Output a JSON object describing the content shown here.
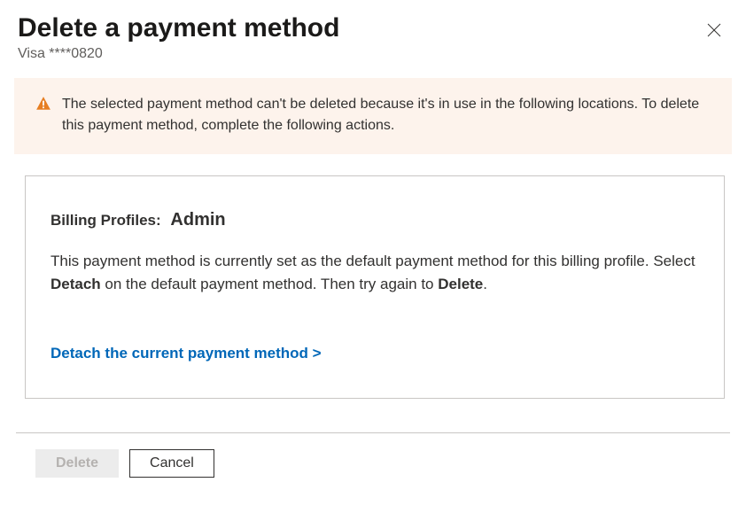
{
  "header": {
    "title": "Delete a payment method",
    "subtitle": "Visa ****0820"
  },
  "warning": {
    "text": "The selected payment method can't be deleted because it's in use in the following locations. To delete this payment method, complete the following actions."
  },
  "card": {
    "label": "Billing Profiles:",
    "value": "Admin",
    "description_pre": "This payment method is currently set as the default payment method for this billing profile. Select ",
    "description_bold1": "Detach",
    "description_mid": " on the default payment method. Then try again to ",
    "description_bold2": "Delete",
    "description_end": ".",
    "link": "Detach the current payment method >"
  },
  "footer": {
    "delete": "Delete",
    "cancel": "Cancel"
  }
}
